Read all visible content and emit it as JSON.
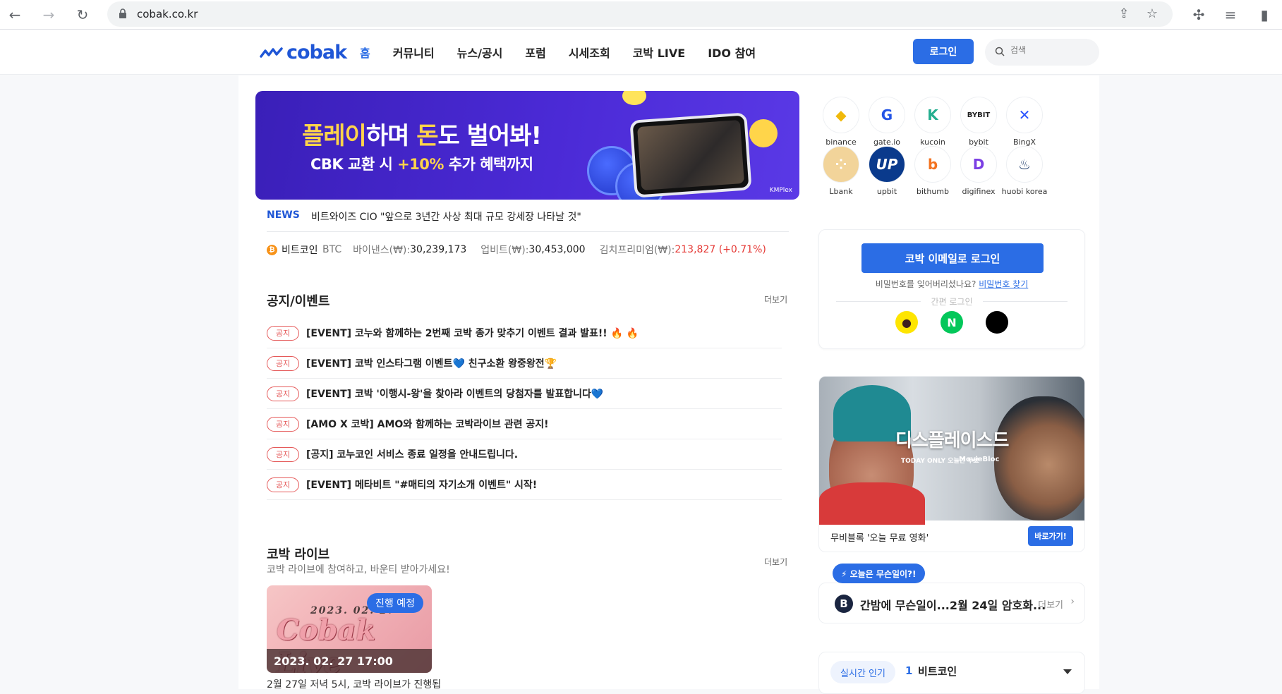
{
  "browser": {
    "url": "cobak.co.kr"
  },
  "header": {
    "logo": "cobak",
    "nav": [
      "홈",
      "커뮤니티",
      "뉴스/공시",
      "포럼",
      "시세조회",
      "코박 LIVE",
      "IDO 참여"
    ],
    "login": "로그인",
    "search_placeholder": "검색"
  },
  "banner": {
    "line1_a": "플레이",
    "line1_b": "하며 ",
    "line1_c": "돈",
    "line1_d": "도 벌어봐!",
    "line2_a": "CBK 교환 시 ",
    "line2_b": "+10%",
    "line2_c": " 추가 혜택까지",
    "brand": "KMPlex"
  },
  "news": {
    "tag": "NEWS",
    "text": "비트와이즈 CIO \"앞으로 3년간 사상 최대 규모 강세장 나타날 것\""
  },
  "ticker": {
    "coin": "비트코인",
    "symbol": "BTC",
    "binance_label": "바이낸스(₩): ",
    "binance_value": "30,239,173",
    "upbit_label": "업비트(₩): ",
    "upbit_value": "30,453,000",
    "kimchi_label": "김치프리미엄(₩): ",
    "kimchi_value": "213,827 (+0.71%)"
  },
  "notices": {
    "title": "공지/이벤트",
    "more": "더보기",
    "badge": "공지",
    "items": [
      "[EVENT] 코누와 함께하는 2번째 코박 종가 맞추기 이벤트 결과 발표!! 🔥 🔥",
      "[EVENT] 코박 인스타그램 이벤트💙 친구소환 왕중왕전🏆",
      "[EVENT] 코박 '이행시-왕'을 찾아라 이벤트의 당첨자를 발표합니다💙",
      "[AMO X 코박] AMO와 함께하는 코박라이브 관련 공지!",
      "[공지] 코누코인 서비스 종료 일정을 안내드립니다.",
      "[EVENT] 메타비트 \"#매티의 자기소개 이벤트\" 시작!"
    ]
  },
  "live": {
    "title": "코박 라이브",
    "subtitle": "코박 라이브에 참여하고, 바운티 받아가세요!",
    "more": "더보기",
    "card_date_script": "2023. 02. 27",
    "card_script": "Cobak Live",
    "status": "진행 예정",
    "datetime": "2023. 02. 27 17:00",
    "desc": "2월 27일 저녁 5시, 코박 라이브가 진행됩"
  },
  "exchanges": [
    {
      "name": "binance",
      "color": "#f0b90b",
      "glyph": "◆"
    },
    {
      "name": "gate.io",
      "color": "#2354e6",
      "glyph": "G"
    },
    {
      "name": "kucoin",
      "color": "#24ae8f",
      "glyph": "K"
    },
    {
      "name": "bybit",
      "color": "#222222",
      "glyph": "BYBIT"
    },
    {
      "name": "BingX",
      "color": "#2a54ff",
      "glyph": "✕"
    },
    {
      "name": "Lbank",
      "color": "#f2d49a",
      "glyph": "⁘"
    },
    {
      "name": "upbit",
      "color": "#0a3a8c",
      "glyph": "UP"
    },
    {
      "name": "bithumb",
      "color": "#f37321",
      "glyph": "b"
    },
    {
      "name": "digifinex",
      "color": "#7b3fe4",
      "glyph": "D"
    },
    {
      "name": "huobi korea",
      "color": "#1b3a6b",
      "glyph": "♨"
    }
  ],
  "login_box": {
    "email_button": "코박 이메일로 로그인",
    "pw_text": "비밀번호를 잊어버리셨나요? ",
    "pw_link": "비밀번호 찾기",
    "simple_login": "간편 로그인"
  },
  "movie": {
    "title": "디스플레이스드",
    "free": "TODAY ONLY 오늘만 무료",
    "brand": "MovieBloc",
    "caption": "무비블록 '오늘 무료 영화'",
    "button": "바로가기!"
  },
  "today": {
    "tag": "⚡ 오늘은 무슨일이?!",
    "text": "간밤에 무슨일이...2월 24일 암호화...",
    "more": "더보기"
  },
  "popular": {
    "pill": "실시간 인기",
    "rank": "1",
    "coin": "비트코인"
  }
}
